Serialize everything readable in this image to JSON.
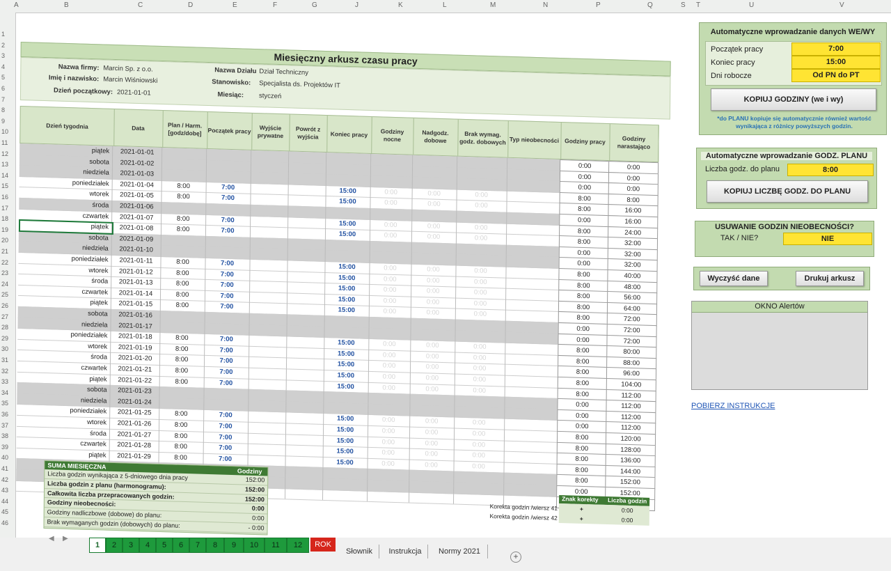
{
  "columns": [
    "A",
    "B",
    "C",
    "D",
    "E",
    "F",
    "G",
    "J",
    "K",
    "L",
    "M",
    "N",
    "P",
    "Q",
    "S",
    "T",
    "U",
    "V"
  ],
  "sheet": {
    "title": "Miesięczny arkusz czasu pracy",
    "info": {
      "firma_label": "Nazwa firmy:",
      "firma": "Marcin Sp. z o.o.",
      "imie_label": "Imię i nazwisko:",
      "imie": "Marcin Wiśniowski",
      "dzien_label": "Dzień początkowy:",
      "dzien": "2021-01-01",
      "dzial_label": "Nazwa Działu",
      "dzial": "Dział Techniczny",
      "stan_label": "Stanowisko:",
      "stan": "Specjalista ds. Projektów IT",
      "mies_label": "Miesiąc:",
      "mies": "styczeń"
    },
    "headers": [
      "Dzień tygodnia",
      "Data",
      "Plan / Harm. [godz/dobę]",
      "Początek pracy",
      "Wyjście prywatne",
      "Powrót z wyjścia",
      "Koniec pracy",
      "Godziny nocne",
      "Nadgodz. dobowe",
      "Brak wymag. godz. dobowych",
      "Typ nieobecności",
      "Godziny pracy",
      "Godziny narastająco"
    ],
    "rows": [
      [
        "piątek",
        "2021-01-01",
        "",
        "",
        "",
        "0:00",
        "0:00"
      ],
      [
        "sobota",
        "2021-01-02",
        "",
        "",
        "",
        "0:00",
        "0:00"
      ],
      [
        "niedziela",
        "2021-01-03",
        "",
        "",
        "",
        "0:00",
        "0:00"
      ],
      [
        "poniedziałek",
        "2021-01-04",
        "8:00",
        "7:00",
        "15:00",
        "8:00",
        "8:00"
      ],
      [
        "wtorek",
        "2021-01-05",
        "8:00",
        "7:00",
        "15:00",
        "8:00",
        "16:00"
      ],
      [
        "środa",
        "2021-01-06",
        "",
        "",
        "",
        "0:00",
        "16:00"
      ],
      [
        "czwartek",
        "2021-01-07",
        "8:00",
        "7:00",
        "15:00",
        "8:00",
        "24:00"
      ],
      [
        "piątek",
        "2021-01-08",
        "8:00",
        "7:00",
        "15:00",
        "8:00",
        "32:00"
      ],
      [
        "sobota",
        "2021-01-09",
        "",
        "",
        "",
        "0:00",
        "32:00"
      ],
      [
        "niedziela",
        "2021-01-10",
        "",
        "",
        "",
        "0:00",
        "32:00"
      ],
      [
        "poniedziałek",
        "2021-01-11",
        "8:00",
        "7:00",
        "15:00",
        "8:00",
        "40:00"
      ],
      [
        "wtorek",
        "2021-01-12",
        "8:00",
        "7:00",
        "15:00",
        "8:00",
        "48:00"
      ],
      [
        "środa",
        "2021-01-13",
        "8:00",
        "7:00",
        "15:00",
        "8:00",
        "56:00"
      ],
      [
        "czwartek",
        "2021-01-14",
        "8:00",
        "7:00",
        "15:00",
        "8:00",
        "64:00"
      ],
      [
        "piątek",
        "2021-01-15",
        "8:00",
        "7:00",
        "15:00",
        "8:00",
        "72:00"
      ],
      [
        "sobota",
        "2021-01-16",
        "",
        "",
        "",
        "0:00",
        "72:00"
      ],
      [
        "niedziela",
        "2021-01-17",
        "",
        "",
        "",
        "0:00",
        "72:00"
      ],
      [
        "poniedziałek",
        "2021-01-18",
        "8:00",
        "7:00",
        "15:00",
        "8:00",
        "80:00"
      ],
      [
        "wtorek",
        "2021-01-19",
        "8:00",
        "7:00",
        "15:00",
        "8:00",
        "88:00"
      ],
      [
        "środa",
        "2021-01-20",
        "8:00",
        "7:00",
        "15:00",
        "8:00",
        "96:00"
      ],
      [
        "czwartek",
        "2021-01-21",
        "8:00",
        "7:00",
        "15:00",
        "8:00",
        "104:00"
      ],
      [
        "piątek",
        "2021-01-22",
        "8:00",
        "7:00",
        "15:00",
        "8:00",
        "112:00"
      ],
      [
        "sobota",
        "2021-01-23",
        "",
        "",
        "",
        "0:00",
        "112:00"
      ],
      [
        "niedziela",
        "2021-01-24",
        "",
        "",
        "",
        "0:00",
        "112:00"
      ],
      [
        "poniedziałek",
        "2021-01-25",
        "8:00",
        "7:00",
        "15:00",
        "0:00",
        "112:00"
      ],
      [
        "wtorek",
        "2021-01-26",
        "8:00",
        "7:00",
        "15:00",
        "8:00",
        "120:00"
      ],
      [
        "środa",
        "2021-01-27",
        "8:00",
        "7:00",
        "15:00",
        "8:00",
        "128:00"
      ],
      [
        "czwartek",
        "2021-01-28",
        "8:00",
        "7:00",
        "15:00",
        "8:00",
        "136:00"
      ],
      [
        "piątek",
        "2021-01-29",
        "8:00",
        "7:00",
        "15:00",
        "8:00",
        "144:00"
      ],
      [
        "sobota",
        "2021-01-30",
        "",
        "",
        "",
        "8:00",
        "152:00"
      ],
      [
        "niedziela",
        "2021-01-31",
        "",
        "",
        "",
        "0:00",
        "152:00"
      ],
      [
        "",
        "",
        "",
        "",
        "",
        "0:00",
        "152:00"
      ]
    ],
    "faint": "0:00",
    "summary": {
      "title": "SUMA MIESIĘCZNA",
      "col": "Godziny",
      "items": [
        {
          "label": "Liczba godzin wynikająca z 5-dniowego dnia pracy",
          "value": "152:00"
        },
        {
          "label": "Liczba godzin z planu (harmonogramu):",
          "value": "152:00"
        },
        {
          "label": "Całkowita liczba przepracowanych godzin:",
          "value": "152:00"
        },
        {
          "label": "Godziny nieobecności:",
          "value": "0:00"
        },
        {
          "label": "Godziny nadliczbowe (dobowe) do planu:",
          "value": "0:00"
        },
        {
          "label": "Brak wymaganych godzin (dobowych) do planu:",
          "value": "- 0:00"
        }
      ]
    },
    "korekta": {
      "h1": "Znak korekty",
      "h2": "Liczba godzin",
      "r1": "Korekta godzin /wiersz 41",
      "s1": "+",
      "v1": "0:00",
      "r2": "Korekta godzin /wiersz 42",
      "s2": "+",
      "v2": "0:00"
    }
  },
  "panels": {
    "weWy": {
      "title": "Automatyczne wprowadzanie danych WE/WY",
      "l1": "Początek pracy",
      "v1": "7:00",
      "l2": "Koniec pracy",
      "v2": "15:00",
      "l3": "Dni robocze",
      "v3": "Od PN do PT",
      "button": "KOPIUJ GODZINY (we i wy)",
      "note": "*do PLANU kopiuje się automatycznie również wartość wynikająca z różnicy powyższych godzin."
    },
    "plan": {
      "title": "Automatyczne wprowadzanie GODZ. PLANU",
      "label": "Liczba godz. do planu",
      "value": "8:00",
      "button": "KOPIUJ LICZBĘ GODZ. DO PLANU"
    },
    "usuwanie": {
      "title": "USUWANIE GODZIN NIEOBECNOŚCI?",
      "label": "TAK / NIE?",
      "value": "NIE"
    },
    "actions": {
      "clear": "Wyczyść dane",
      "print": "Drukuj arkusz"
    },
    "alerts": {
      "title": "OKNO Alertów"
    },
    "link": "POBIERZ INSTRUKCJE"
  },
  "tabs": [
    "1",
    "2",
    "3",
    "4",
    "5",
    "6",
    "7",
    "8",
    "9",
    "10",
    "11",
    "12",
    "ROK",
    "Słownik",
    "Instrukcja",
    "Normy 2021"
  ],
  "colors": {
    "green_tab": "#1e9a3c",
    "red_tab": "#d6261b",
    "panel": "#c3dbb0",
    "yellow": "#ffe433",
    "blue_text": "#1f4fa0"
  }
}
